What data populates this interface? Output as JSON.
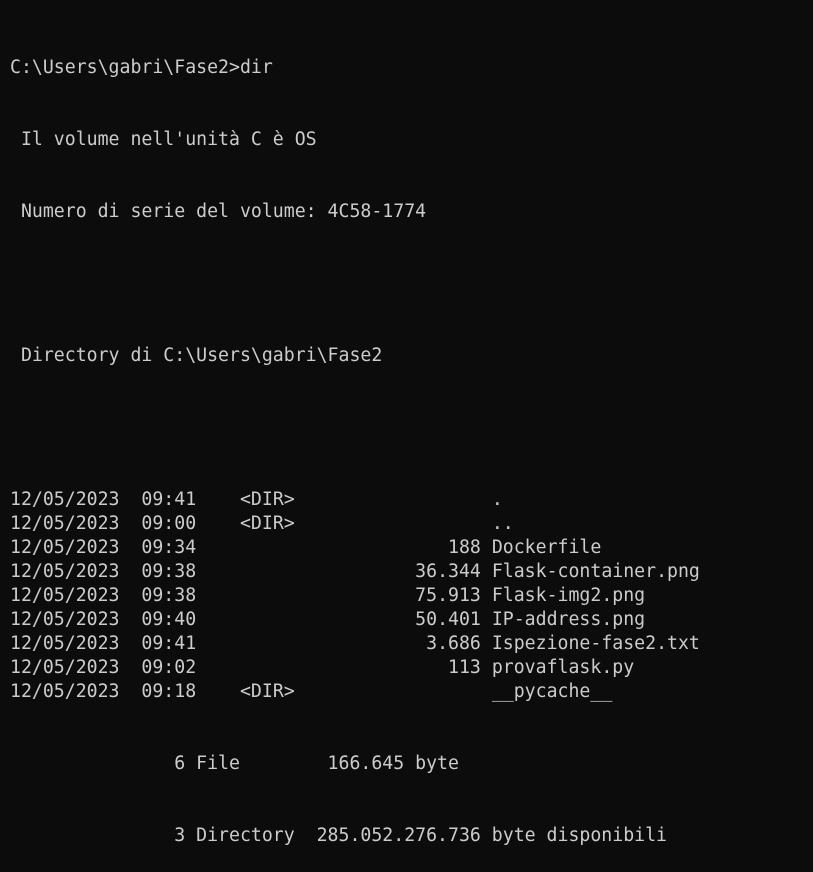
{
  "terminal": {
    "prompt": "C:\\Users\\gabri\\Fase2>",
    "command": "dir",
    "volume_line": " Il volume nell'unità C è OS",
    "serial_line": " Numero di serie del volume: 4C58-1774",
    "directory_line": " Directory di C:\\Users\\gabri\\Fase2",
    "entries": [
      {
        "date": "12/05/2023",
        "time": "09:41",
        "type": "<DIR>",
        "size": "",
        "name": "."
      },
      {
        "date": "12/05/2023",
        "time": "09:00",
        "type": "<DIR>",
        "size": "",
        "name": ".."
      },
      {
        "date": "12/05/2023",
        "time": "09:34",
        "type": "",
        "size": "188",
        "name": "Dockerfile"
      },
      {
        "date": "12/05/2023",
        "time": "09:38",
        "type": "",
        "size": "36.344",
        "name": "Flask-container.png"
      },
      {
        "date": "12/05/2023",
        "time": "09:38",
        "type": "",
        "size": "75.913",
        "name": "Flask-img2.png"
      },
      {
        "date": "12/05/2023",
        "time": "09:40",
        "type": "",
        "size": "50.401",
        "name": "IP-address.png"
      },
      {
        "date": "12/05/2023",
        "time": "09:41",
        "type": "",
        "size": "3.686",
        "name": "Ispezione-fase2.txt"
      },
      {
        "date": "12/05/2023",
        "time": "09:02",
        "type": "",
        "size": "113",
        "name": "provaflask.py"
      },
      {
        "date": "12/05/2023",
        "time": "09:18",
        "type": "<DIR>",
        "size": "",
        "name": "__pycache__"
      }
    ],
    "summary_files": "               6 File        166.645 byte",
    "summary_dirs": "               3 Directory  285.052.276.736 byte disponibili"
  },
  "colors": {
    "background": "#0c0c0c",
    "text": "#cccccc"
  }
}
